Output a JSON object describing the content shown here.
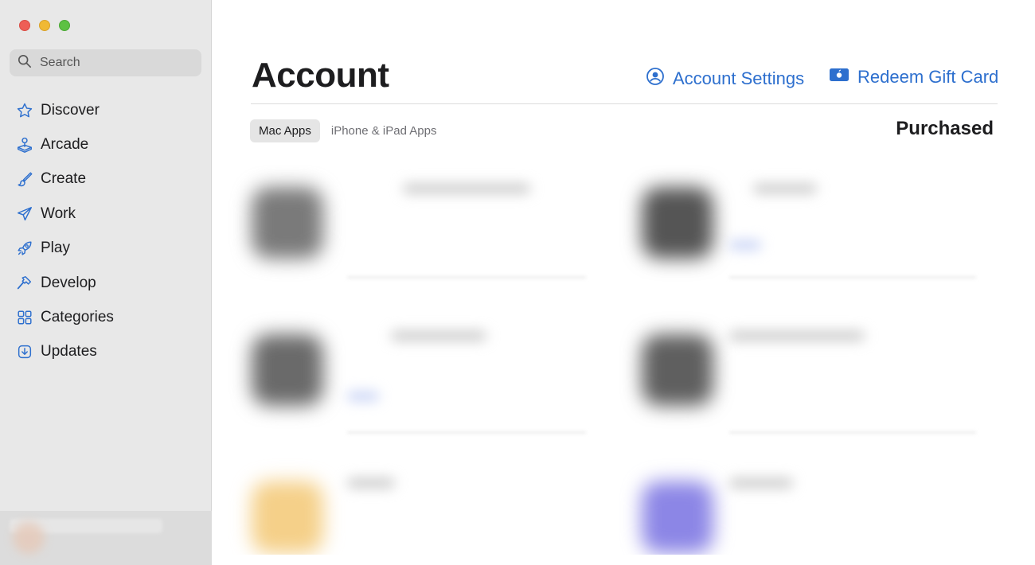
{
  "sidebar": {
    "search_placeholder": "Search",
    "items": [
      {
        "label": "Discover",
        "icon": "star-icon"
      },
      {
        "label": "Arcade",
        "icon": "joystick-icon"
      },
      {
        "label": "Create",
        "icon": "paintbrush-icon"
      },
      {
        "label": "Work",
        "icon": "paperplane-icon"
      },
      {
        "label": "Play",
        "icon": "rocket-icon"
      },
      {
        "label": "Develop",
        "icon": "hammer-icon"
      },
      {
        "label": "Categories",
        "icon": "grid-icon"
      },
      {
        "label": "Updates",
        "icon": "download-icon"
      }
    ]
  },
  "main": {
    "title": "Account",
    "account_settings_label": "Account Settings",
    "redeem_label": "Redeem Gift Card",
    "tabs": [
      {
        "label": "Mac Apps",
        "active": true
      },
      {
        "label": "iPhone & iPad Apps",
        "active": false
      }
    ],
    "section_title": "Purchased"
  },
  "colors": {
    "accent": "#2d6fce",
    "sidebar_bg": "#e8e8e8",
    "icon_blue": "#2d6fce"
  }
}
